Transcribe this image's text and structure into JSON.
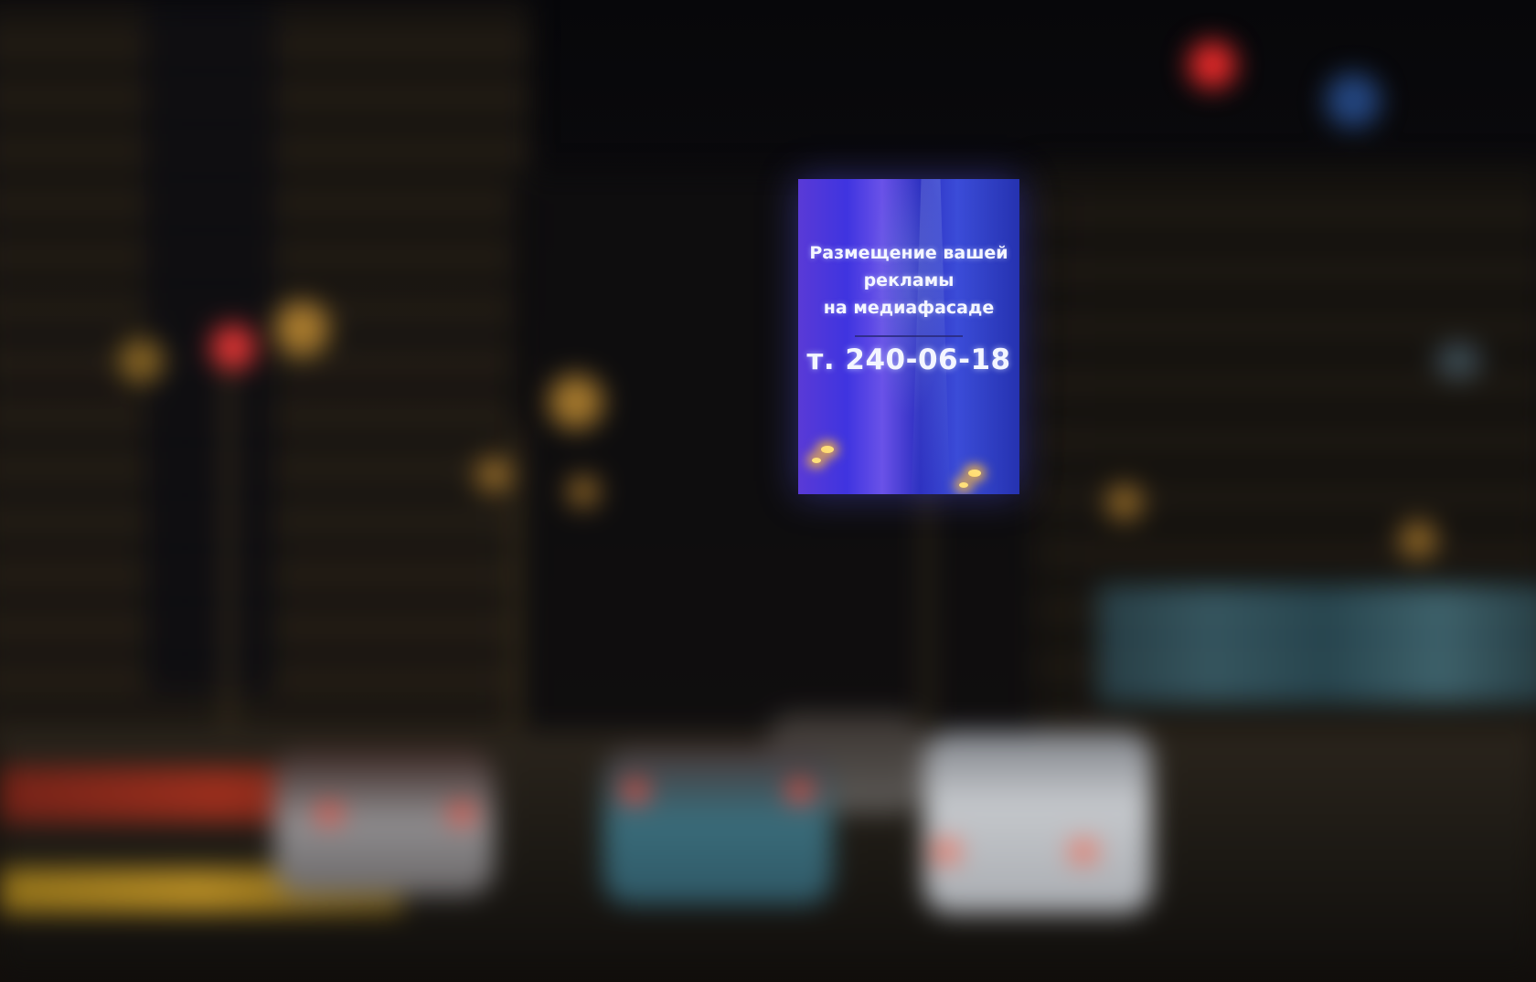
{
  "scene": {
    "description_colors": {
      "billboard_left": "#5a3ad6",
      "billboard_right": "#2532b0",
      "billboard_text": "#f4f6ff",
      "lamp_glow": "#ffe07a"
    }
  },
  "billboard": {
    "headline_line1": "Размещение вашей",
    "headline_line2": "рекламы",
    "headline_line3": "на медиафасаде",
    "phone": "т. 240-06-18"
  }
}
